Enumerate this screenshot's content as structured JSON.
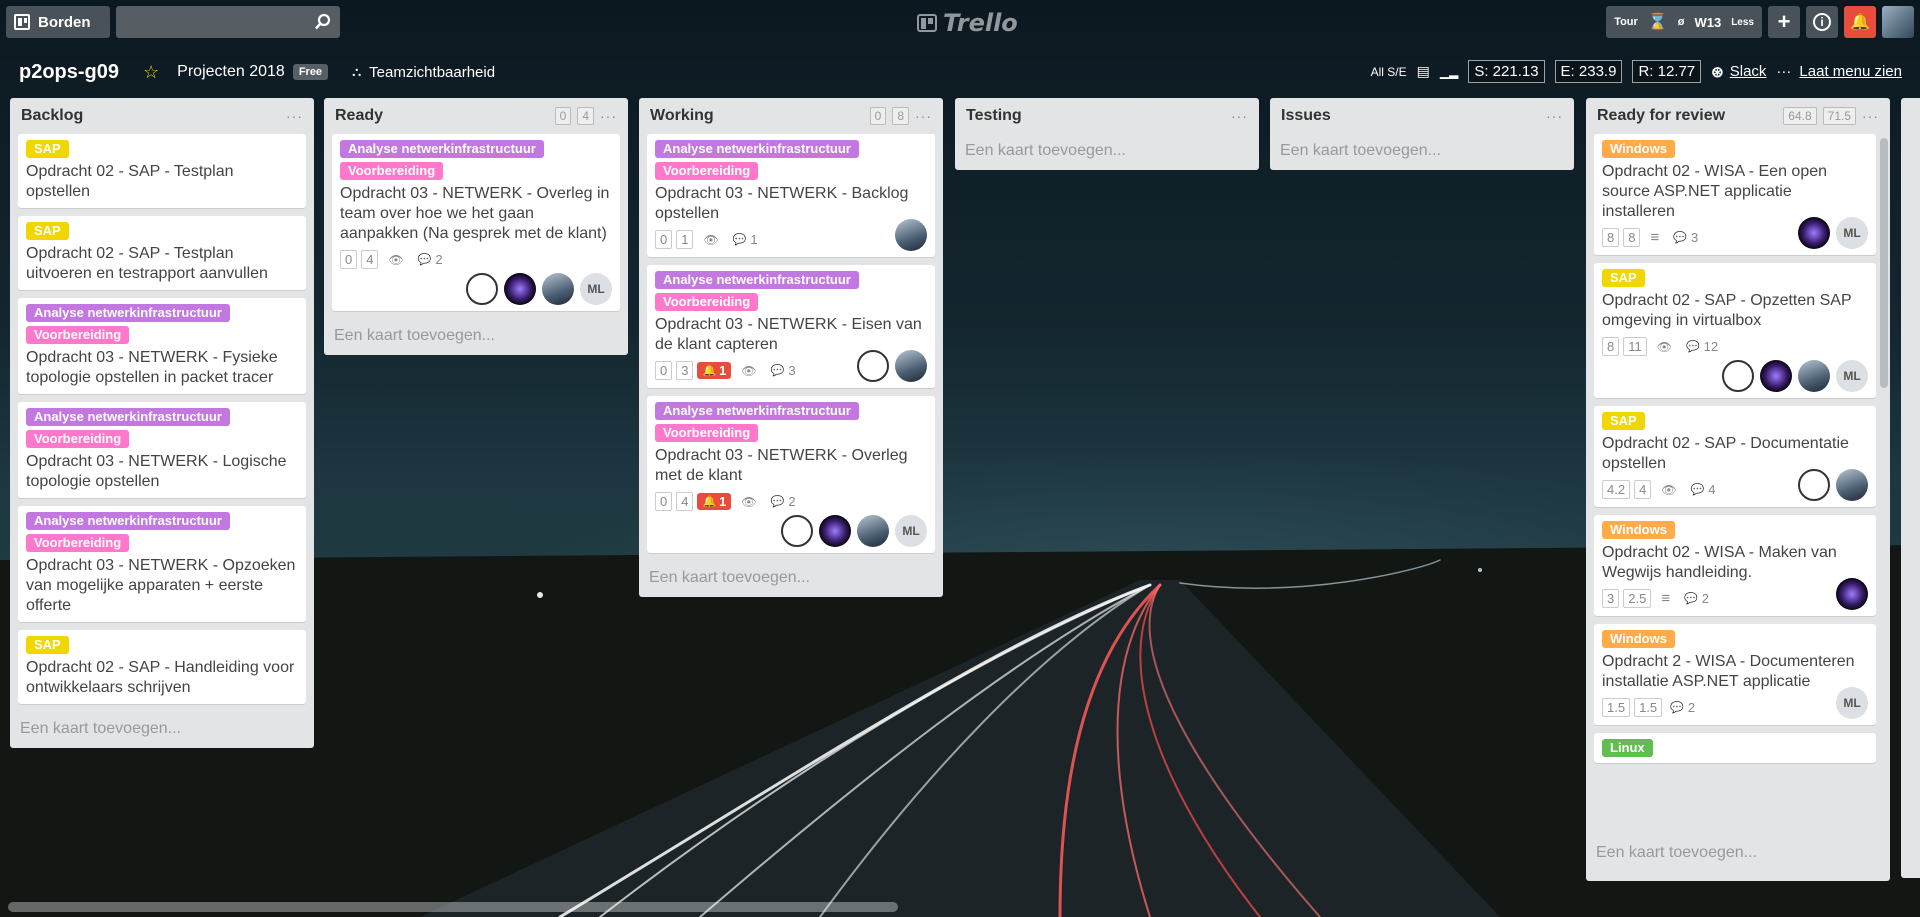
{
  "topbar": {
    "boards_label": "Borden",
    "search_placeholder": "",
    "logo_text": "Trello",
    "plugin": {
      "tour": "Tour",
      "slash": "ø",
      "week": "W13",
      "less": "Less"
    }
  },
  "board": {
    "title": "p2ops-g09",
    "team": "Projecten 2018",
    "team_badge": "Free",
    "visibility": "Teamzichtbaarheid",
    "all_se": "All S/E",
    "stat_s": "S: 221.13",
    "stat_e": "E: 233.9",
    "stat_r": "R: 12.77",
    "slack": "Slack",
    "menu": "Laat menu zien"
  },
  "colors": {
    "label_sap": "#f2d600",
    "label_purple": "#c377e0",
    "label_pink": "#ff78cb",
    "label_orange": "#ffab4a",
    "label_green": "#61bd4f",
    "alert": "#e74c3c"
  },
  "add_card": "Een kaart toevoegen...",
  "lists": [
    {
      "title": "Backlog",
      "counts": [],
      "cards": [
        {
          "labels": [
            {
              "text": "SAP",
              "color": "#f2d600"
            }
          ],
          "title": "Opdracht 02 - SAP - Testplan opstellen"
        },
        {
          "labels": [
            {
              "text": "SAP",
              "color": "#f2d600"
            }
          ],
          "title": "Opdracht 02 - SAP - Testplan uitvoeren en testrapport aanvullen"
        },
        {
          "labels": [
            {
              "text": "Analyse netwerkinfrastructuur",
              "color": "#c377e0"
            },
            {
              "text": "Voorbereiding",
              "color": "#ff78cb"
            }
          ],
          "title": "Opdracht 03 - NETWERK - Fysieke topologie opstellen in packet tracer"
        },
        {
          "labels": [
            {
              "text": "Analyse netwerkinfrastructuur",
              "color": "#c377e0"
            },
            {
              "text": "Voorbereiding",
              "color": "#ff78cb"
            }
          ],
          "title": "Opdracht 03 - NETWERK - Logische topologie opstellen"
        },
        {
          "labels": [
            {
              "text": "Analyse netwerkinfrastructuur",
              "color": "#c377e0"
            },
            {
              "text": "Voorbereiding",
              "color": "#ff78cb"
            }
          ],
          "title": "Opdracht 03 - NETWERK - Opzoeken van mogelijke apparaten + eerste offerte"
        },
        {
          "labels": [
            {
              "text": "SAP",
              "color": "#f2d600"
            }
          ],
          "title": "Opdracht 02 - SAP - Handleiding voor ontwikkelaars schrijven"
        }
      ]
    },
    {
      "title": "Ready",
      "counts": [
        "0",
        "4"
      ],
      "cards": [
        {
          "labels": [
            {
              "text": "Analyse netwerkinfrastructuur",
              "color": "#c377e0"
            },
            {
              "text": "Voorbereiding",
              "color": "#ff78cb"
            }
          ],
          "title": "Opdracht 03 - NETWERK - Overleg in team over hoe we het gaan aanpakken (Na gesprek met de klant)",
          "nums": [
            "0",
            "4"
          ],
          "watch": true,
          "comments": "2",
          "members": [
            "lion",
            "purple",
            "photo",
            "ML"
          ]
        }
      ]
    },
    {
      "title": "Working",
      "counts": [
        "0",
        "8"
      ],
      "cards": [
        {
          "labels": [
            {
              "text": "Analyse netwerkinfrastructuur",
              "color": "#c377e0"
            },
            {
              "text": "Voorbereiding",
              "color": "#ff78cb"
            }
          ],
          "title": "Opdracht 03 - NETWERK - Backlog opstellen",
          "nums": [
            "0",
            "1"
          ],
          "watch": true,
          "comments": "1",
          "members": [
            "photo"
          ]
        },
        {
          "labels": [
            {
              "text": "Analyse netwerkinfrastructuur",
              "color": "#c377e0"
            },
            {
              "text": "Voorbereiding",
              "color": "#ff78cb"
            }
          ],
          "title": "Opdracht 03 - NETWERK - Eisen van de klant capteren",
          "nums": [
            "0",
            "3"
          ],
          "alert": "1",
          "watch": true,
          "comments": "3",
          "members": [
            "lion",
            "photo"
          ]
        },
        {
          "labels": [
            {
              "text": "Analyse netwerkinfrastructuur",
              "color": "#c377e0"
            },
            {
              "text": "Voorbereiding",
              "color": "#ff78cb"
            }
          ],
          "title": "Opdracht 03 - NETWERK - Overleg met de klant",
          "nums": [
            "0",
            "4"
          ],
          "alert": "1",
          "watch": true,
          "comments": "2",
          "members": [
            "lion",
            "purple",
            "photo",
            "ML"
          ]
        }
      ]
    },
    {
      "title": "Testing",
      "counts": [],
      "cards": []
    },
    {
      "title": "Issues",
      "counts": [],
      "cards": []
    },
    {
      "title": "Ready for review",
      "counts": [
        "64.8",
        "71.5"
      ],
      "cards": [
        {
          "labels": [
            {
              "text": "Windows",
              "color": "#ffab4a"
            }
          ],
          "title": "Opdracht 02 - WISA - Een open source ASP.NET applicatie installeren",
          "nums": [
            "8",
            "8"
          ],
          "desc": true,
          "comments": "3",
          "members": [
            "purple",
            "ML"
          ]
        },
        {
          "labels": [
            {
              "text": "SAP",
              "color": "#f2d600"
            }
          ],
          "title": "Opdracht 02 - SAP - Opzetten SAP omgeving in virtualbox",
          "nums": [
            "8",
            "11"
          ],
          "watch": true,
          "comments": "12",
          "members": [
            "lion",
            "purple",
            "photo",
            "ML"
          ]
        },
        {
          "labels": [
            {
              "text": "SAP",
              "color": "#f2d600"
            }
          ],
          "title": "Opdracht 02 - SAP - Documentatie opstellen",
          "nums": [
            "4.2",
            "4"
          ],
          "watch": true,
          "comments": "4",
          "members": [
            "lion",
            "photo"
          ]
        },
        {
          "labels": [
            {
              "text": "Windows",
              "color": "#ffab4a"
            }
          ],
          "title": "Opdracht 02 - WISA - Maken van Wegwijs handleiding.",
          "nums": [
            "3",
            "2.5"
          ],
          "desc": true,
          "comments": "2",
          "members": [
            "purple"
          ]
        },
        {
          "labels": [
            {
              "text": "Windows",
              "color": "#ffab4a"
            }
          ],
          "title": "Opdracht 2 - WISA - Documenteren installatie ASP.NET applicatie",
          "nums": [
            "1.5",
            "1.5"
          ],
          "comments": "2",
          "members": [
            "ML"
          ]
        },
        {
          "labels": [
            {
              "text": "Linux",
              "color": "#61bd4f"
            }
          ],
          "title": "",
          "partial": true
        }
      ]
    }
  ]
}
